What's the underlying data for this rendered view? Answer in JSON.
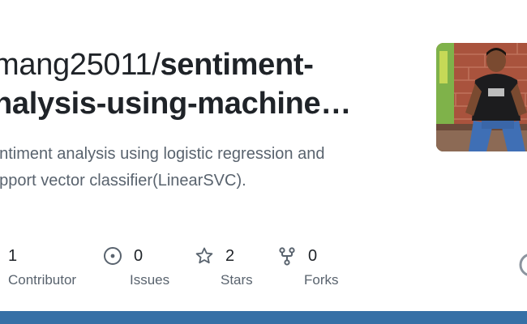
{
  "repo": {
    "owner_line": "mang25011/",
    "name_line1": "sentiment-",
    "name_line2": "nalysis-using-machine…",
    "description_line1": "entiment analysis using logistic regression and",
    "description_line2": "upport vector classifier(LinearSVC)."
  },
  "stats": [
    {
      "icon": "people-icon",
      "count": "1",
      "label": "Contributor"
    },
    {
      "icon": "issue-opened-icon",
      "count": "0",
      "label": "Issues"
    },
    {
      "icon": "star-icon",
      "count": "2",
      "label": "Stars"
    },
    {
      "icon": "repo-forked-icon",
      "count": "0",
      "label": "Forks"
    }
  ],
  "avatar": {
    "icon": "user-photo"
  },
  "colors": {
    "text_primary": "#1f2328",
    "text_secondary": "#59636e",
    "bottom_bar": "#3670a6"
  }
}
